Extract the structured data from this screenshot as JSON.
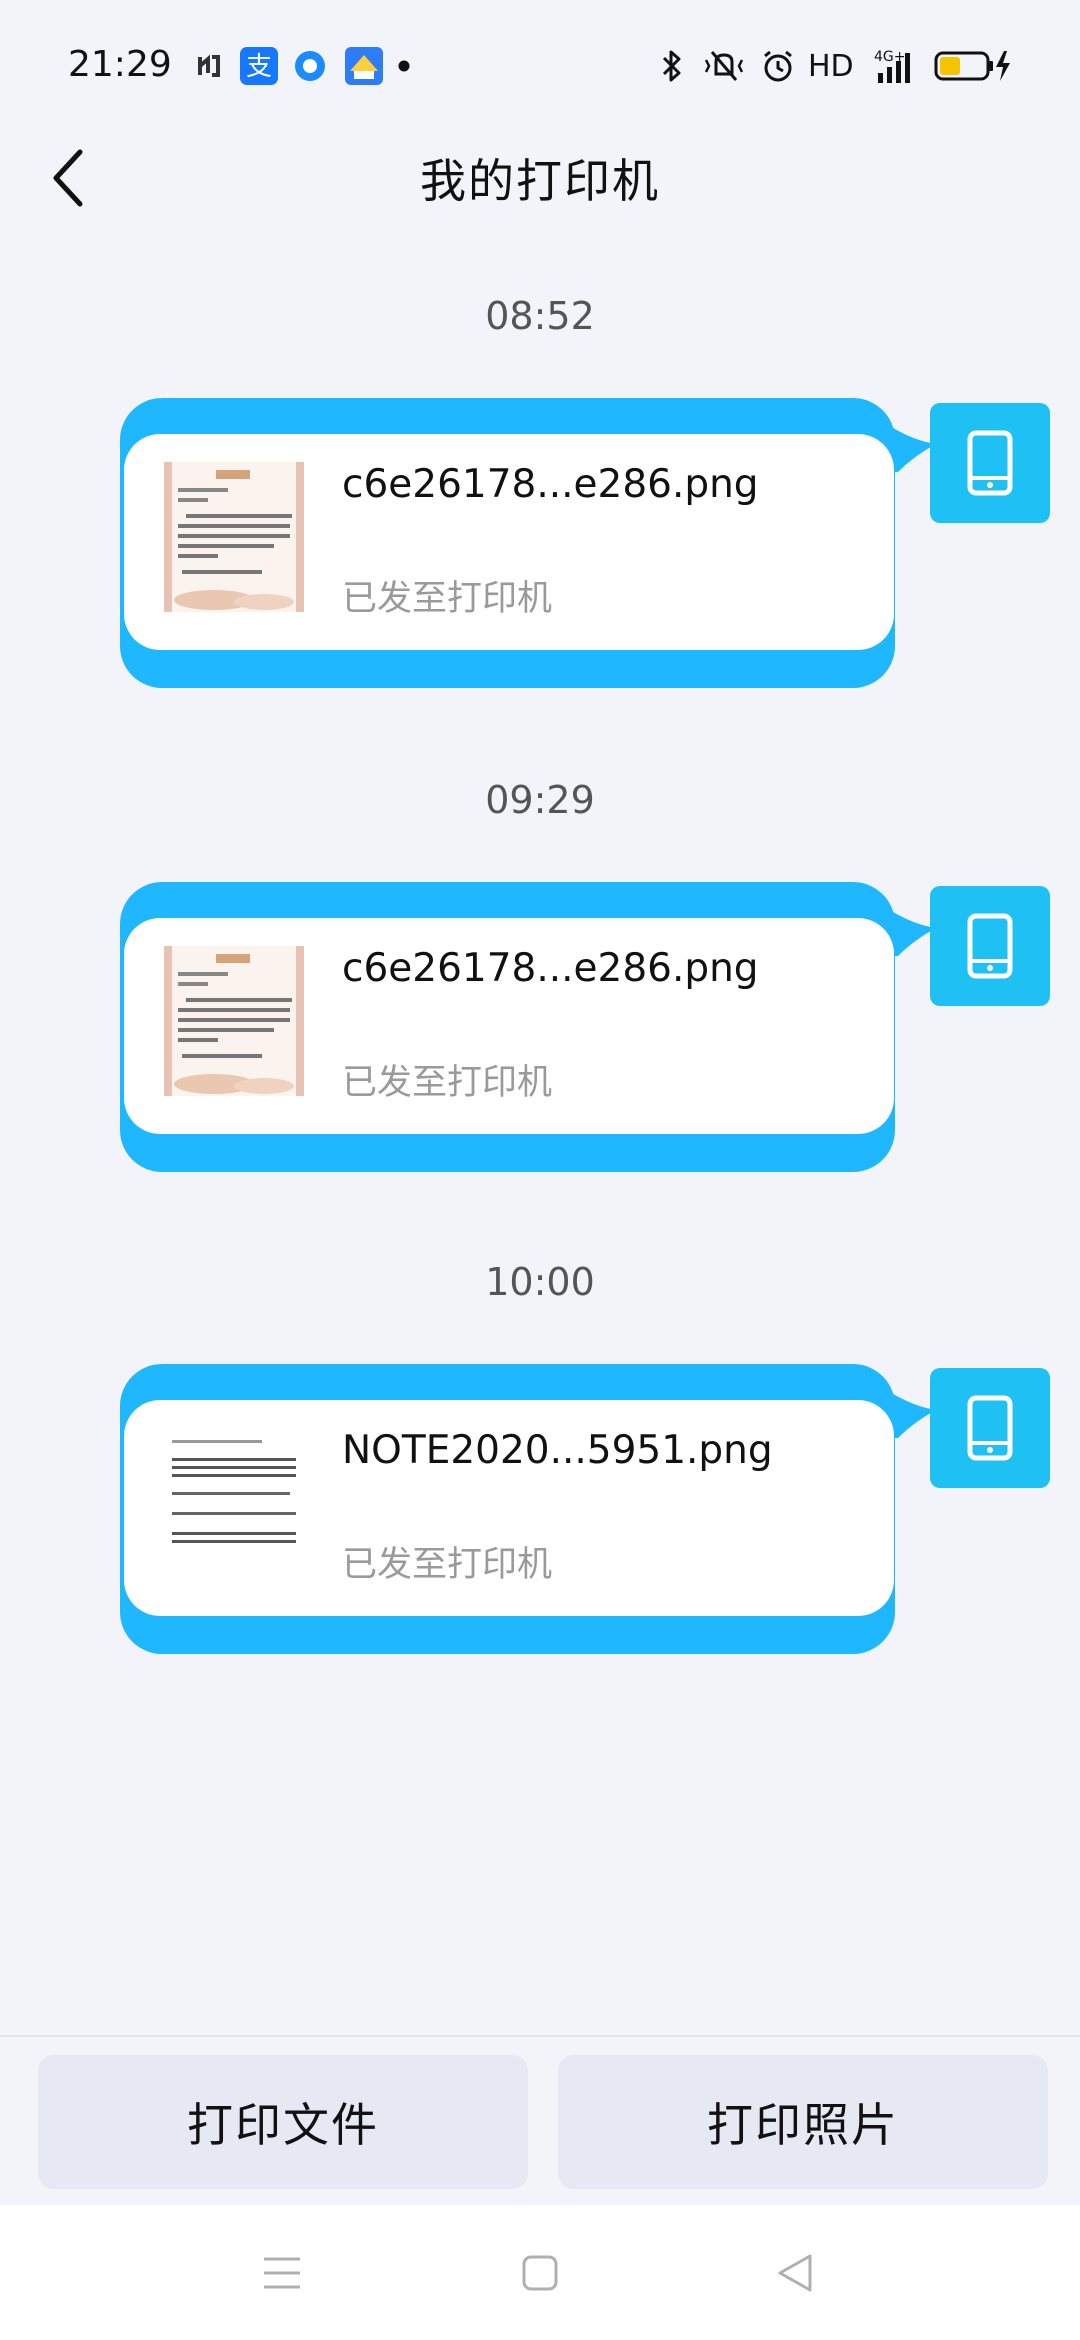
{
  "status_bar": {
    "time": "21:29",
    "apps": [
      "app-icon",
      "alipay-icon",
      "circle-app-icon",
      "house-app-icon"
    ],
    "right_text": "HD",
    "network": "4G+"
  },
  "header": {
    "title": "我的打印机"
  },
  "messages": [
    {
      "time": "08:52",
      "file_name": "c6e26178...e286.png",
      "status": "已发至打印机",
      "thumb": "certificate"
    },
    {
      "time": "09:29",
      "file_name": "c6e26178...e286.png",
      "status": "已发至打印机",
      "thumb": "certificate"
    },
    {
      "time": "10:00",
      "file_name": "NOTE2020...5951.png",
      "status": "已发至打印机",
      "thumb": "note"
    }
  ],
  "actions": {
    "print_file": "打印文件",
    "print_photo": "打印照片"
  },
  "colors": {
    "accent": "#1fb8ff",
    "badge": "#1fc1f5",
    "background": "#f2f4fa"
  }
}
